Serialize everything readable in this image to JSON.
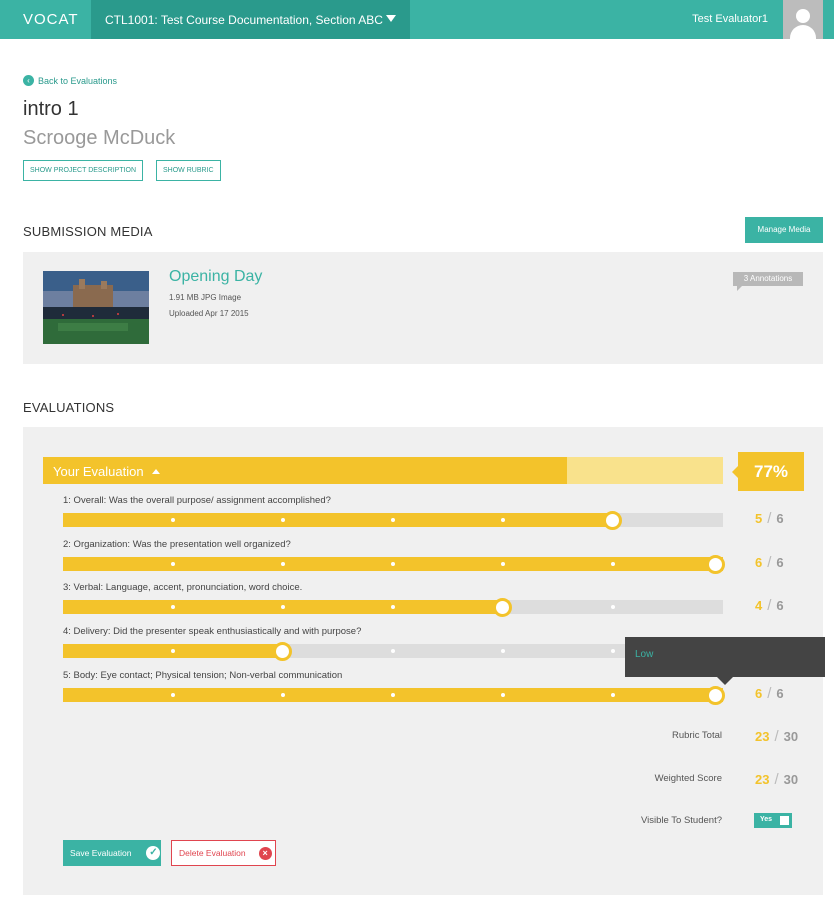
{
  "header": {
    "logo": "VOCAT",
    "course": "CTL1001: Test Course Documentation, Section ABC",
    "user": "Test Evaluator1"
  },
  "nav": {
    "back_label": "Back to Evaluations"
  },
  "project": {
    "title": "intro 1",
    "student": "Scrooge McDuck",
    "show_description": "SHOW PROJECT DESCRIPTION",
    "show_rubric": "SHOW RUBRIC"
  },
  "submission": {
    "heading": "SUBMISSION MEDIA",
    "manage_label": "Manage Media",
    "media": {
      "title": "Opening Day",
      "meta": "1.91 MB JPG Image",
      "uploaded": "Uploaded Apr 17 2015",
      "annotations": "3 Annotations"
    }
  },
  "evaluations": {
    "heading": "EVALUATIONS",
    "your_eval_label": "Your Evaluation",
    "percent": "77%",
    "percent_value": 0.77,
    "criteria": [
      {
        "label": "1: Overall: Was the overall purpose/ assignment accomplished?",
        "score": "5",
        "max": "6",
        "value": 5,
        "max_value": 6
      },
      {
        "label": "2: Organization: Was the presentation well organized?",
        "score": "6",
        "max": "6",
        "value": 6,
        "max_value": 6
      },
      {
        "label": "3: Verbal: Language, accent, pronunciation, word choice.",
        "score": "4",
        "max": "6",
        "value": 4,
        "max_value": 6
      },
      {
        "label": "4: Delivery: Did the presenter speak enthusiastically and with purpose?",
        "score": "",
        "max": "",
        "value": 2,
        "max_value": 6
      },
      {
        "label": "5: Body: Eye contact; Physical tension; Non-verbal communication",
        "score": "6",
        "max": "6",
        "value": 6,
        "max_value": 6
      }
    ],
    "tooltip": "Low",
    "rubric_total_label": "Rubric Total",
    "rubric_total": "23",
    "rubric_max": "30",
    "weighted_label": "Weighted Score",
    "weighted_score": "23",
    "weighted_max": "30",
    "visible_label": "Visible To Student?",
    "visible_value": "Yes",
    "save_label": "Save Evaluation",
    "delete_label": "Delete Evaluation"
  },
  "colors": {
    "teal": "#3bb3a4",
    "yellow": "#f3c32b",
    "red": "#e0454f"
  }
}
